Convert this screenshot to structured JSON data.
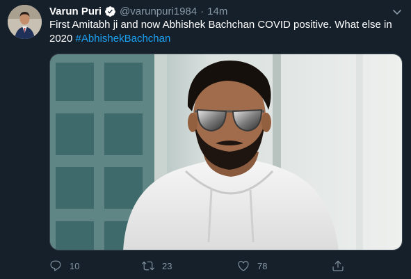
{
  "tweet": {
    "author": {
      "display_name": "Varun Puri",
      "handle": "@varunpuri1984",
      "verified": true,
      "avatar": "avatar-icon"
    },
    "separator": "·",
    "time": "14m",
    "text": "First Amitabh ji and now Abhishek Bachchan COVID positive.  What else in 2020 ",
    "hashtag": "#AbhishekBachchan",
    "stats": {
      "replies": "10",
      "retweets": "23",
      "likes": "78"
    }
  },
  "icons": {
    "verified": "verified-badge-icon",
    "menu": "chevron-down-icon",
    "reply": "reply-icon",
    "retweet": "retweet-icon",
    "like": "heart-icon",
    "share": "share-icon"
  },
  "colors": {
    "background": "#15202b",
    "text": "#ffffff",
    "secondary": "#8899a6",
    "accent": "#1da1f2"
  }
}
